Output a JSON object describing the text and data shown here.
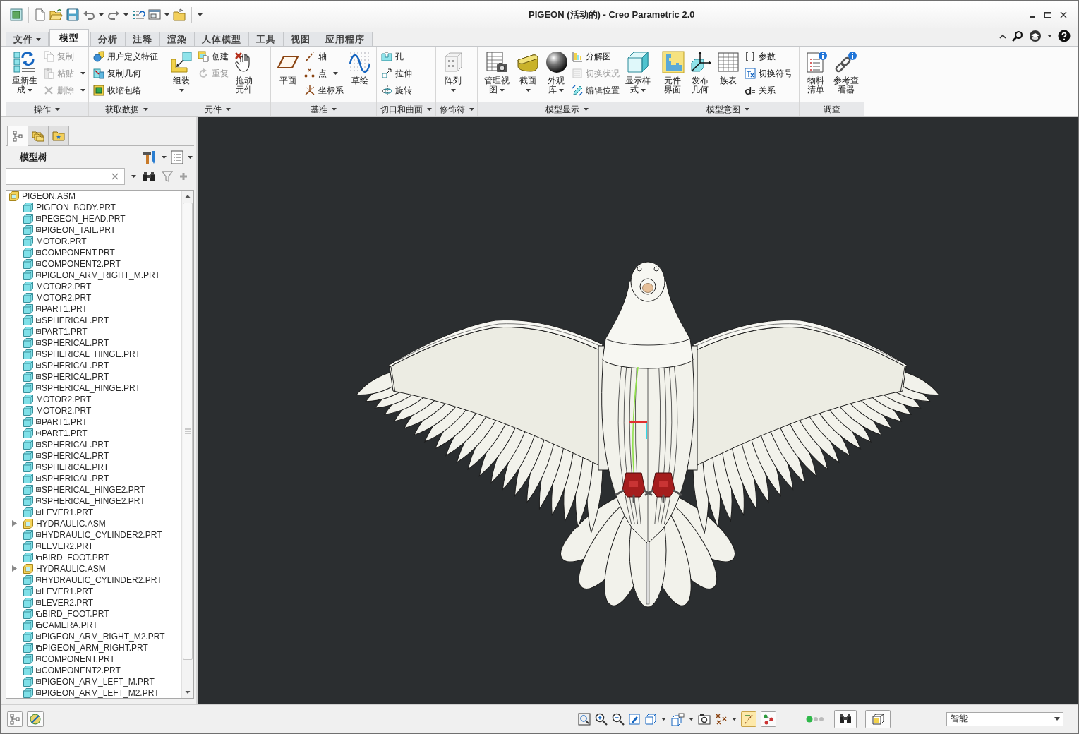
{
  "window": {
    "title": "PIGEON (活动的) - Creo Parametric 2.0"
  },
  "ribbon_tabs": [
    {
      "label": "文件",
      "selected": false,
      "dropdown": true
    },
    {
      "label": "模型",
      "selected": true,
      "dropdown": false
    },
    {
      "label": "分析",
      "selected": false,
      "dropdown": false
    },
    {
      "label": "注释",
      "selected": false,
      "dropdown": false
    },
    {
      "label": "渲染",
      "selected": false,
      "dropdown": false
    },
    {
      "label": "人体模型",
      "selected": false,
      "dropdown": false
    },
    {
      "label": "工具",
      "selected": false,
      "dropdown": false
    },
    {
      "label": "视图",
      "selected": false,
      "dropdown": false
    },
    {
      "label": "应用程序",
      "selected": false,
      "dropdown": false
    }
  ],
  "ribbon_groups": [
    {
      "label": "操作",
      "dropdown": true,
      "commands": [
        {
          "label": "重新生成",
          "kind": "large",
          "disabled": false,
          "dropdown": true
        },
        {
          "label": "复制",
          "kind": "small",
          "disabled": true,
          "dropdown": false
        },
        {
          "label": "粘贴",
          "kind": "small",
          "disabled": true,
          "dropdown": true
        },
        {
          "label": "删除",
          "kind": "small",
          "disabled": true,
          "dropdown": true
        }
      ]
    },
    {
      "label": "获取数据",
      "dropdown": true,
      "commands": [
        {
          "label": "用户定义特征",
          "kind": "small",
          "disabled": false,
          "dropdown": false
        },
        {
          "label": "复制几何",
          "kind": "small",
          "disabled": false,
          "dropdown": false
        },
        {
          "label": "收缩包络",
          "kind": "small",
          "disabled": false,
          "dropdown": false
        }
      ]
    },
    {
      "label": "元件",
      "dropdown": true,
      "commands": [
        {
          "label": "组装",
          "kind": "large",
          "disabled": false,
          "dropdown": true
        },
        {
          "label": "创建",
          "kind": "small",
          "disabled": false,
          "dropdown": false
        },
        {
          "label": "重复",
          "kind": "small",
          "disabled": true,
          "dropdown": false
        },
        {
          "label": "拖动元件",
          "kind": "large",
          "disabled": false,
          "dropdown": false
        }
      ]
    },
    {
      "label": "基准",
      "dropdown": true,
      "commands": [
        {
          "label": "平面",
          "kind": "large",
          "disabled": false,
          "dropdown": false
        },
        {
          "label": "轴",
          "kind": "small",
          "disabled": false,
          "dropdown": false
        },
        {
          "label": "点",
          "kind": "small",
          "disabled": false,
          "dropdown": true
        },
        {
          "label": "坐标系",
          "kind": "small",
          "disabled": false,
          "dropdown": false
        },
        {
          "label": "草绘",
          "kind": "large",
          "disabled": false,
          "dropdown": false
        }
      ]
    },
    {
      "label": "切口和曲面",
      "dropdown": true,
      "commands": [
        {
          "label": "孔",
          "kind": "small",
          "disabled": false,
          "dropdown": false
        },
        {
          "label": "拉伸",
          "kind": "small",
          "disabled": false,
          "dropdown": false
        },
        {
          "label": "旋转",
          "kind": "small",
          "disabled": false,
          "dropdown": false
        }
      ]
    },
    {
      "label": "修饰符",
      "dropdown": true,
      "commands": [
        {
          "label": "阵列",
          "kind": "large",
          "disabled": false,
          "dropdown": true
        }
      ]
    },
    {
      "label": "模型显示",
      "dropdown": true,
      "commands": [
        {
          "label": "管理视图",
          "kind": "large",
          "disabled": false,
          "dropdown": true
        },
        {
          "label": "截面",
          "kind": "large",
          "disabled": false,
          "dropdown": true
        },
        {
          "label": "外观库",
          "kind": "large",
          "disabled": false,
          "dropdown": true
        },
        {
          "label": "分解图",
          "kind": "small",
          "disabled": false,
          "dropdown": false
        },
        {
          "label": "切换状况",
          "kind": "small",
          "disabled": true,
          "dropdown": false
        },
        {
          "label": "编辑位置",
          "kind": "small",
          "disabled": false,
          "dropdown": false
        },
        {
          "label": "显示样式",
          "kind": "large",
          "disabled": false,
          "dropdown": true
        }
      ]
    },
    {
      "label": "模型意图",
      "dropdown": true,
      "commands": [
        {
          "label": "元件界面",
          "kind": "large",
          "disabled": false,
          "dropdown": false
        },
        {
          "label": "发布几何",
          "kind": "large",
          "disabled": false,
          "dropdown": false
        },
        {
          "label": "族表",
          "kind": "large",
          "disabled": false,
          "dropdown": false
        },
        {
          "label": "参数",
          "kind": "small",
          "disabled": false,
          "dropdown": false
        },
        {
          "label": "切换符号",
          "kind": "small",
          "disabled": false,
          "dropdown": false
        },
        {
          "label": "关系",
          "kind": "small",
          "disabled": false,
          "dropdown": false
        }
      ]
    },
    {
      "label": "调查",
      "dropdown": false,
      "commands": [
        {
          "label": "物料清单",
          "kind": "large",
          "disabled": false,
          "dropdown": false
        },
        {
          "label": "参考查看器",
          "kind": "large",
          "disabled": false,
          "dropdown": false
        }
      ]
    }
  ],
  "navigator_tabs": [
    {
      "selected": true
    },
    {
      "selected": false
    },
    {
      "selected": false
    }
  ],
  "model_tree": {
    "title": "模型树",
    "items": [
      {
        "name": "PIGEON.ASM",
        "kind": "assembly",
        "children": [
          {
            "name": "PIGEON_BODY.PRT",
            "kind": "part"
          },
          {
            "name": "PEGEON_HEAD.PRT",
            "kind": "marked_part"
          },
          {
            "name": "PIGEON_TAIL.PRT",
            "kind": "marked_part"
          },
          {
            "name": "MOTOR.PRT",
            "kind": "part"
          },
          {
            "name": "COMPONENT.PRT",
            "kind": "marked_part"
          },
          {
            "name": "COMPONENT2.PRT",
            "kind": "marked_part"
          },
          {
            "name": "PIGEON_ARM_RIGHT_M.PRT",
            "kind": "marked_part"
          },
          {
            "name": "MOTOR2.PRT",
            "kind": "part"
          },
          {
            "name": "MOTOR2.PRT",
            "kind": "part"
          },
          {
            "name": "PART1.PRT",
            "kind": "marked_part"
          },
          {
            "name": "SPHERICAL.PRT",
            "kind": "marked_part"
          },
          {
            "name": "PART1.PRT",
            "kind": "marked_part"
          },
          {
            "name": "SPHERICAL.PRT",
            "kind": "marked_part"
          },
          {
            "name": "SPHERICAL_HINGE.PRT",
            "kind": "marked_part"
          },
          {
            "name": "SPHERICAL.PRT",
            "kind": "marked_part"
          },
          {
            "name": "SPHERICAL.PRT",
            "kind": "marked_part"
          },
          {
            "name": "SPHERICAL_HINGE.PRT",
            "kind": "marked_part"
          },
          {
            "name": "MOTOR2.PRT",
            "kind": "part"
          },
          {
            "name": "MOTOR2.PRT",
            "kind": "part"
          },
          {
            "name": "PART1.PRT",
            "kind": "marked_part"
          },
          {
            "name": "PART1.PRT",
            "kind": "marked_part"
          },
          {
            "name": "SPHERICAL.PRT",
            "kind": "marked_part"
          },
          {
            "name": "SPHERICAL.PRT",
            "kind": "marked_part"
          },
          {
            "name": "SPHERICAL.PRT",
            "kind": "marked_part"
          },
          {
            "name": "SPHERICAL.PRT",
            "kind": "marked_part"
          },
          {
            "name": "SPHERICAL_HINGE2.PRT",
            "kind": "marked_part"
          },
          {
            "name": "SPHERICAL_HINGE2.PRT",
            "kind": "marked_part"
          },
          {
            "name": "LEVER1.PRT",
            "kind": "marked_part"
          },
          {
            "name": "HYDRAULIC.ASM",
            "kind": "assembly",
            "expanded": false
          },
          {
            "name": "HYDRAULIC_CYLINDER2.PRT",
            "kind": "marked_part"
          },
          {
            "name": "LEVER2.PRT",
            "kind": "marked_part"
          },
          {
            "name": "BIRD_FOOT.PRT",
            "kind": "linked_part"
          },
          {
            "name": "HYDRAULIC.ASM",
            "kind": "assembly",
            "expanded": false
          },
          {
            "name": "HYDRAULIC_CYLINDER2.PRT",
            "kind": "marked_part"
          },
          {
            "name": "LEVER1.PRT",
            "kind": "marked_part"
          },
          {
            "name": "LEVER2.PRT",
            "kind": "marked_part"
          },
          {
            "name": "BIRD_FOOT.PRT",
            "kind": "linked_part"
          },
          {
            "name": "CAMERA.PRT",
            "kind": "linked_part"
          },
          {
            "name": "PIGEON_ARM_RIGHT_M2.PRT",
            "kind": "marked_part"
          },
          {
            "name": "PIGEON_ARM_RIGHT.PRT",
            "kind": "linked_part"
          },
          {
            "name": "COMPONENT.PRT",
            "kind": "marked_part"
          },
          {
            "name": "COMPONENT2.PRT",
            "kind": "marked_part"
          },
          {
            "name": "PIGEON_ARM_LEFT_M.PRT",
            "kind": "marked_part"
          },
          {
            "name": "PIGEON_ARM_LEFT_M2.PRT",
            "kind": "marked_part"
          }
        ]
      }
    ]
  },
  "status_bar": {
    "selection_filter": "智能"
  }
}
